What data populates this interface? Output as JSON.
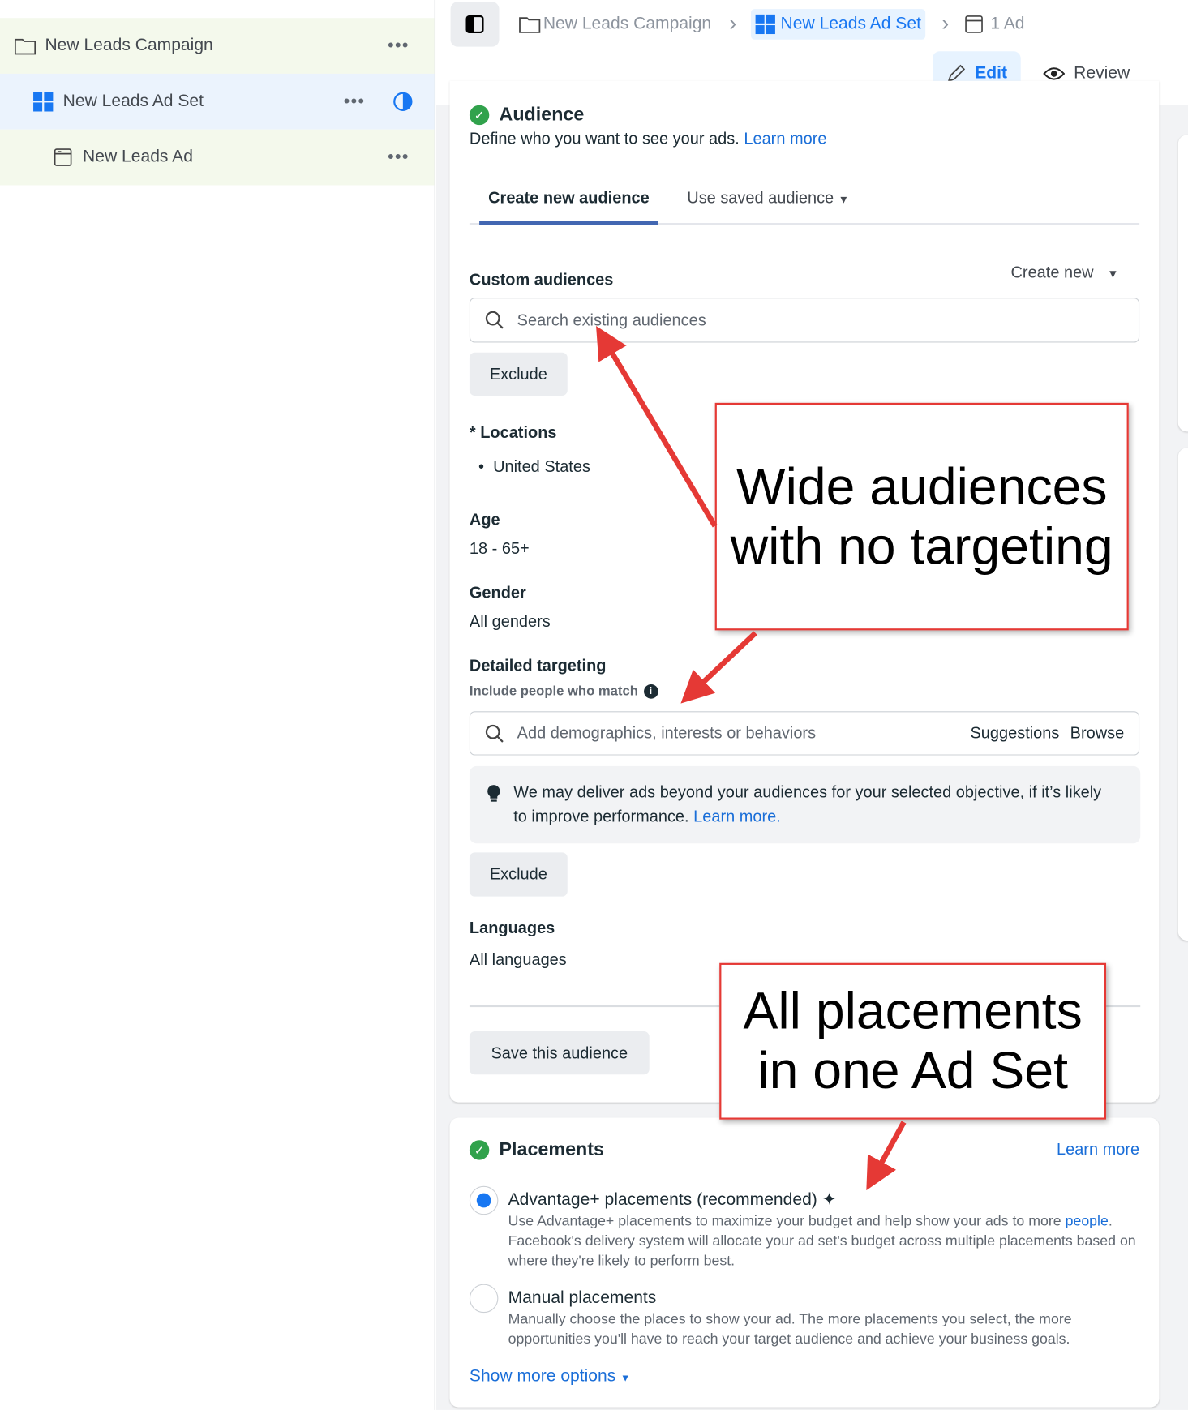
{
  "sidebar": {
    "items": [
      {
        "label": "New Leads Campaign",
        "icon": "folder-icon"
      },
      {
        "label": "New Leads Ad Set",
        "icon": "grid-icon"
      },
      {
        "label": "New Leads Ad",
        "icon": "ad-icon"
      }
    ],
    "more_glyph": "•••"
  },
  "breadcrumb": {
    "items": [
      "New Leads Campaign",
      "New Leads Ad Set",
      "1 Ad"
    ],
    "separator": "›"
  },
  "toolbar": {
    "edit_label": "Edit",
    "review_label": "Review"
  },
  "audience": {
    "title": "Audience",
    "description": "Define who you want to see your ads.",
    "learn_more": "Learn more",
    "tabs": [
      "Create new audience",
      "Use saved audience"
    ],
    "custom_audiences_label": "Custom audiences",
    "create_new_label": "Create new",
    "search_placeholder": "Search existing audiences",
    "exclude_label": "Exclude",
    "locations_label": "* Locations",
    "location_value": "United States",
    "age_label": "Age",
    "age_value": "18 - 65+",
    "gender_label": "Gender",
    "gender_value": "All genders",
    "detailed_targeting_label": "Detailed targeting",
    "include_label": "Include people who match",
    "targeting_placeholder": "Add demographics, interests or behaviors",
    "suggestions_label": "Suggestions",
    "browse_label": "Browse",
    "notice_text": "We may deliver ads beyond your audiences for your selected objective, if it’s likely to improve performance.",
    "notice_link": "Learn more.",
    "exclude2_label": "Exclude",
    "languages_label": "Languages",
    "languages_value": "All languages",
    "save_label": "Save this audience"
  },
  "placements": {
    "title": "Placements",
    "learn_more": "Learn more",
    "options": [
      {
        "label": "Advantage+ placements (recommended)",
        "desc": "Use Advantage+ placements to maximize your budget and help show your ads to more",
        "desc_link": "people",
        "desc2": ". Facebook's delivery system will allocate your ad set's budget across multiple placements based on where they're likely to perform best.",
        "selected": true
      },
      {
        "label": "Manual placements",
        "desc": "Manually choose the places to show your ad. The more placements you select, the more opportunities you'll have to reach your target audience and achieve your business goals.",
        "selected": false
      }
    ],
    "show_more": "Show more options"
  },
  "annotations": {
    "box1": "Wide audiences with no targeting",
    "box2": "All placements in one Ad Set"
  },
  "colors": {
    "accent": "#1a6ed8",
    "annotation": "#e53935",
    "success": "#31a24c"
  }
}
